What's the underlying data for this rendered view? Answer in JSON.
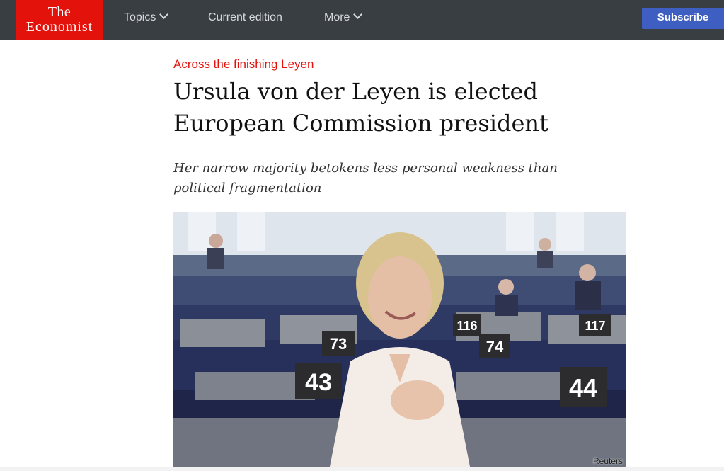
{
  "header": {
    "logo_line1": "The",
    "logo_line2": "Economist",
    "nav": {
      "topics": "Topics",
      "current_edition": "Current edition",
      "more": "More"
    },
    "subscribe_label": "Subscribe"
  },
  "article": {
    "rubric": "Across the finishing Leyen",
    "headline": "Ursula von der Leyen is elected European Commission president",
    "standfirst": "Her narrow majority betokens less personal weakness than political fragmentation",
    "image": {
      "desk_numbers": [
        "43",
        "73",
        "74",
        "116",
        "117",
        "44"
      ],
      "credit": "Reuters"
    }
  },
  "colors": {
    "brand_red": "#e3120b",
    "topbar": "#383e42",
    "subscribe_blue": "#3f5ec2"
  }
}
